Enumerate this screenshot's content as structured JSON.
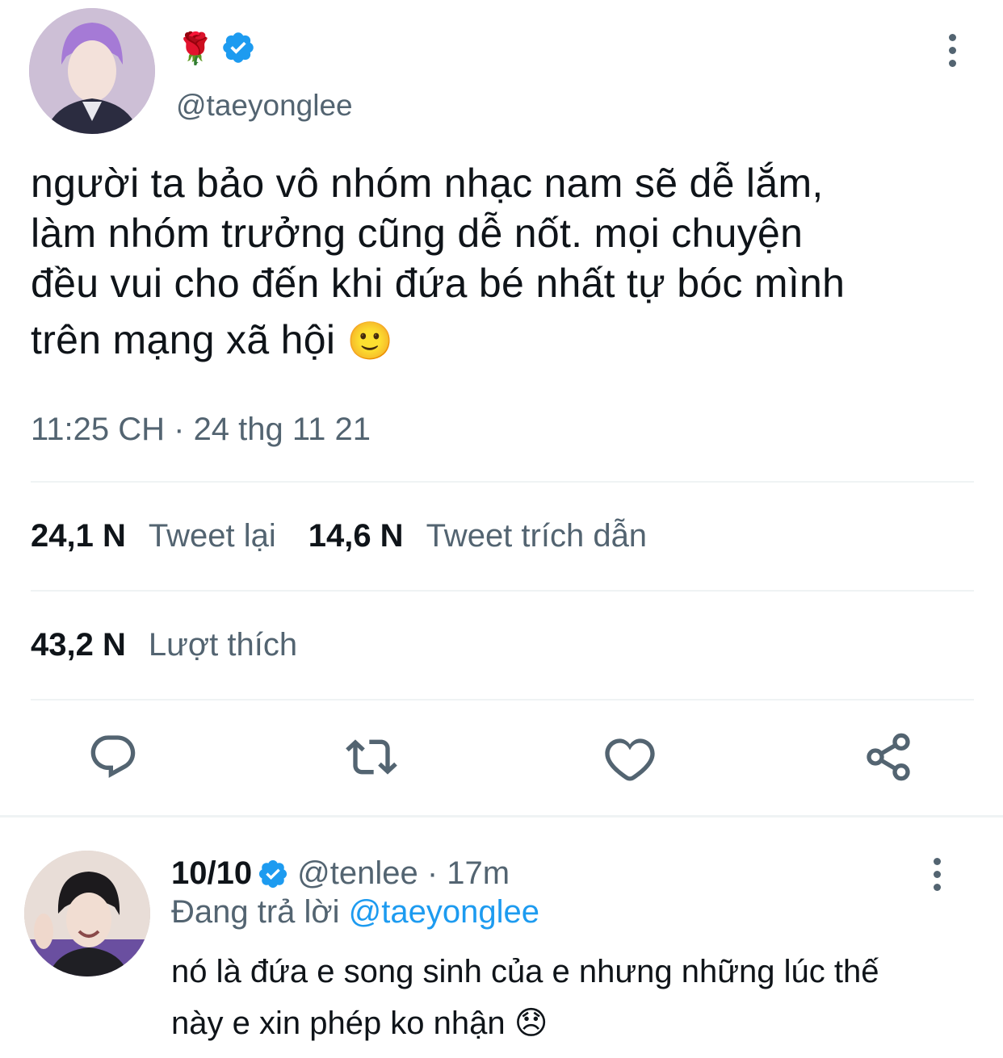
{
  "colors": {
    "verified_blue": "#1d9bf0",
    "text_primary": "#0f1419",
    "text_secondary": "#536471",
    "divider": "#eff3f4",
    "link": "#1d9bf0"
  },
  "tweet": {
    "author_name_emoji": "🌹",
    "verified_icon": "verified-badge-icon",
    "handle": "@taeyonglee",
    "text_lines": [
      "người ta bảo vô nhóm nhạc nam sẽ dễ lắm,",
      "làm nhóm trưởng cũng dễ nốt. mọi chuyện",
      "đều vui cho đến khi đứa bé nhất tự bóc mình",
      "trên mạng xã hội"
    ],
    "text_emoji": "🙂",
    "timestamp": "11:25 CH · 24 thg 11 21",
    "stats": {
      "retweets_count": "24,1 N",
      "retweets_label": "Tweet lại",
      "quotes_count": "14,6 N",
      "quotes_label": "Tweet trích dẫn",
      "likes_count": "43,2 N",
      "likes_label": "Lượt thích"
    },
    "actions": [
      "reply-icon",
      "retweet-icon",
      "like-icon",
      "share-icon"
    ]
  },
  "reply": {
    "name": "10/10",
    "handle": "@tenlee",
    "separator": " · ",
    "time": "17m",
    "replying_prefix": "Đang trả lời ",
    "replying_to": "@taeyonglee",
    "text_lines": [
      "nó là đứa e song sinh của e nhưng những lúc thế",
      "này e xin phép ko nhận"
    ],
    "text_emoji": "😞"
  }
}
